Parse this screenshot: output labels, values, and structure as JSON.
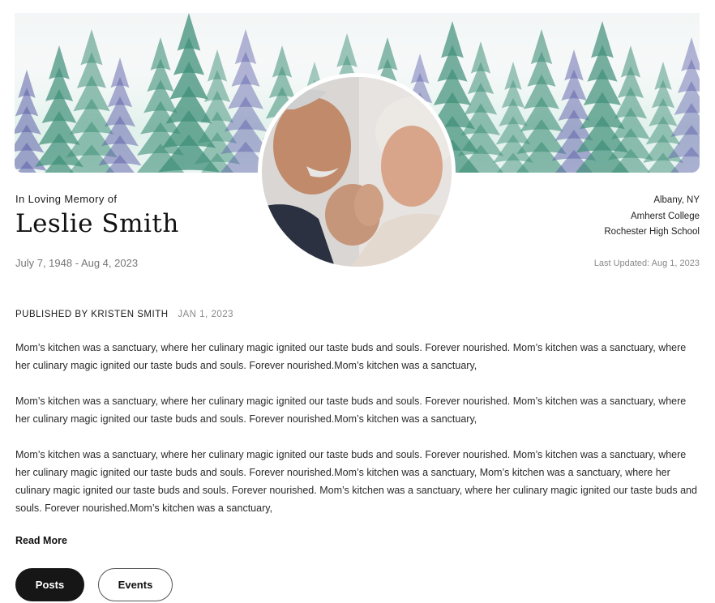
{
  "memorial": {
    "label": "In Loving Memory of",
    "name": "Leslie Smith",
    "dates": "July 7, 1948 - Aug 4, 2023",
    "info": [
      "Albany, NY",
      "Amherst College",
      "Rochester High School"
    ],
    "last_updated": "Last Updated: Aug 1, 2023"
  },
  "post": {
    "published_by": "PUBLISHED BY KRISTEN SMITH",
    "published_date": "JAN 1, 2023",
    "paragraphs": [
      "Mom’s kitchen was a sanctuary, where her culinary magic ignited our taste buds and souls. Forever nourished. Mom’s kitchen was a sanctuary, where her culinary magic ignited our taste buds and souls. Forever nourished.Mom’s kitchen was a sanctuary,",
      "Mom’s kitchen was a sanctuary, where her culinary magic ignited our taste buds and souls. Forever nourished. Mom’s kitchen was a sanctuary, where her culinary magic ignited our taste buds and souls. Forever nourished.Mom’s kitchen was a sanctuary,",
      "Mom’s kitchen was a sanctuary, where her culinary magic ignited our taste buds and souls. Forever nourished. Mom’s kitchen was a sanctuary, where her culinary magic ignited our taste buds and souls. Forever nourished.Mom’s kitchen was a sanctuary, Mom’s kitchen was a sanctuary, where her culinary magic ignited our taste buds and souls. Forever nourished. Mom’s kitchen was a sanctuary, where her culinary magic ignited our taste buds and souls. Forever nourished.Mom’s kitchen was a sanctuary,"
    ],
    "read_more": "Read More"
  },
  "tabs": [
    {
      "label": "Posts",
      "active": true
    },
    {
      "label": "Events",
      "active": false
    }
  ],
  "colors": {
    "tab_active_bg": "#161616",
    "tree_green": "#3f8f78",
    "tree_purple": "#5b5ea8"
  },
  "icons": {
    "banner": "watercolor-pine-forest",
    "portrait": "elderly-couple-photo"
  }
}
